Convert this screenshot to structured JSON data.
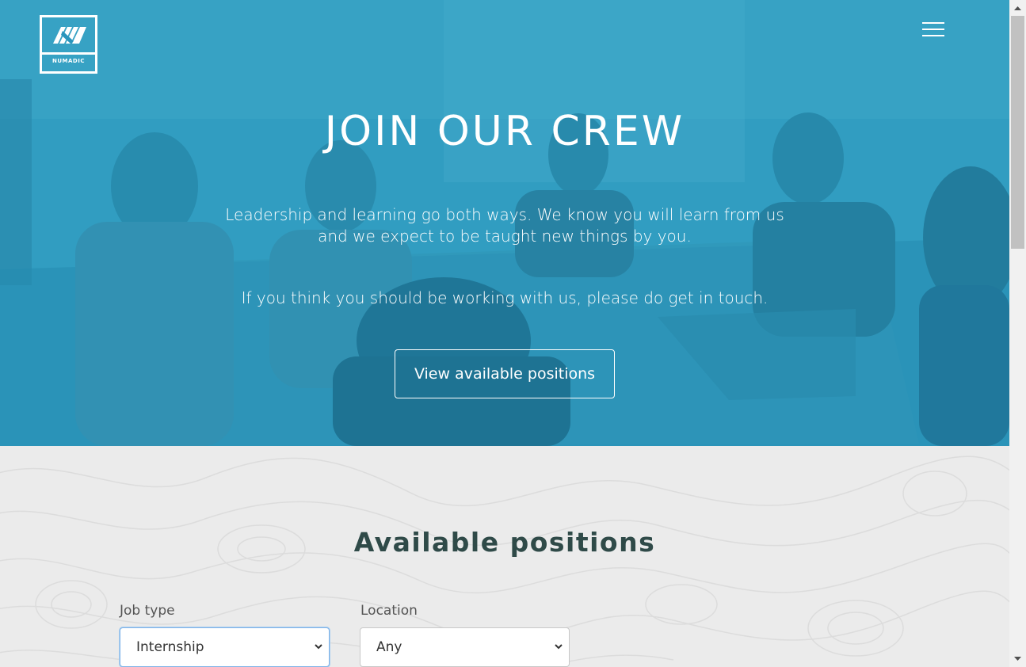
{
  "brand": {
    "name": "NUMADIC"
  },
  "hero": {
    "title": "JOIN OUR CREW",
    "paragraph_1_line_1": "Leadership and learning go both ways. We know you will learn from us",
    "paragraph_1_line_2": "and we expect to be taught new things by you.",
    "paragraph_2": "If you think you should be working with us, please do get in touch.",
    "cta_label": "View available positions"
  },
  "positions": {
    "title": "Available positions",
    "filters": {
      "job_type": {
        "label": "Job type",
        "selected": "Internship"
      },
      "location": {
        "label": "Location",
        "selected": "Any"
      }
    }
  },
  "icons": {
    "menu": "hamburger-menu-icon",
    "select_arrow": "chevron-down-icon"
  },
  "colors": {
    "hero_overlay": "#2a95bc",
    "title_dark": "#2f4a48",
    "focus_border": "#80b4e8"
  }
}
